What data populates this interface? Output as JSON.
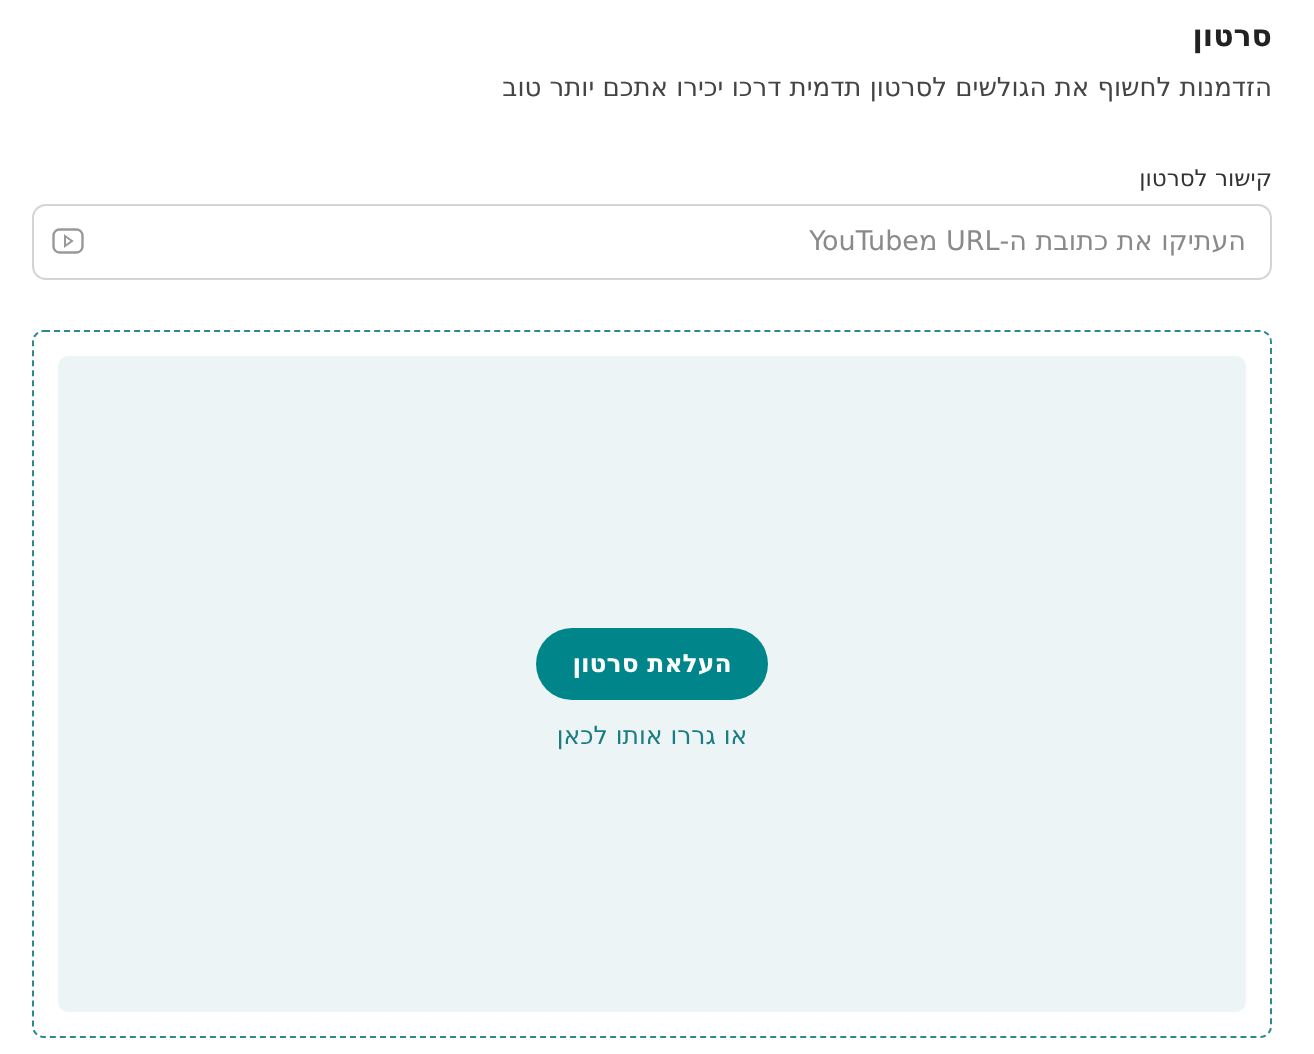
{
  "section": {
    "title": "סרטון",
    "description": "הזדמנות לחשוף את הגולשים לסרטון תדמית דרכו יכירו אתכם יותר טוב"
  },
  "video_link": {
    "label": "קישור לסרטון",
    "placeholder": "העתיקו את כתובת ה-URL מYouTube"
  },
  "upload": {
    "button": "העלאת סרטון",
    "hint": "או גררו אותו לכאן"
  }
}
